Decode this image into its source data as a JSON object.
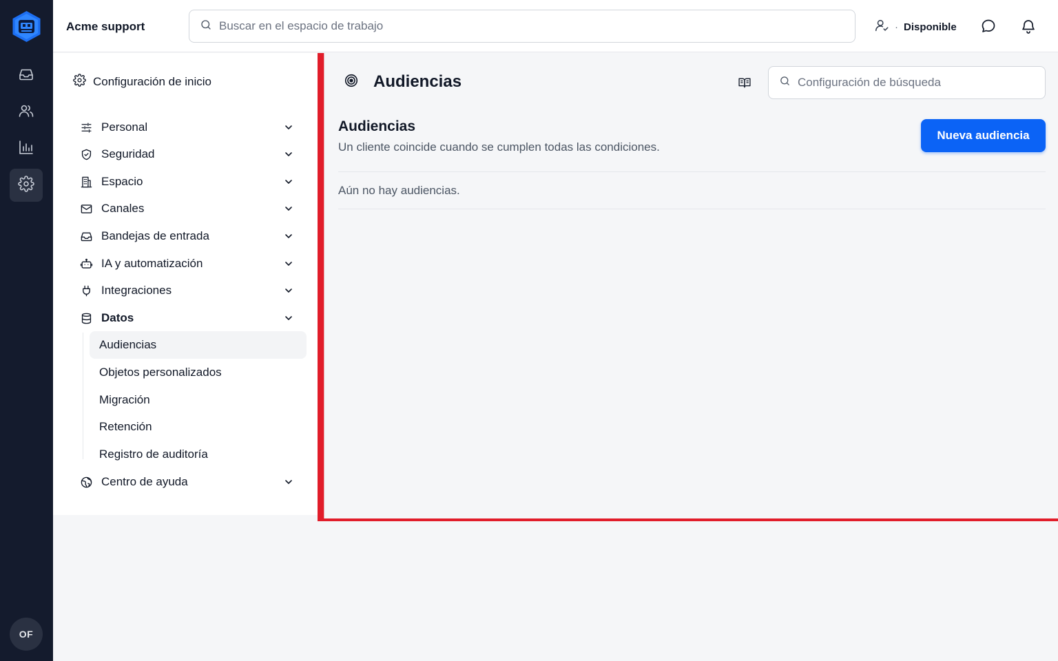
{
  "colors": {
    "rail_bg": "#141b2d",
    "accent": "#0b63f6",
    "highlight_border": "#e11d2a"
  },
  "rail": {
    "logo_icon": "bot-hexagon-logo",
    "items": [
      {
        "icon": "inbox-icon",
        "active": false
      },
      {
        "icon": "users-icon",
        "active": false
      },
      {
        "icon": "bar-chart-icon",
        "active": false
      },
      {
        "icon": "gear-icon",
        "active": true
      }
    ],
    "avatar_initials": "OF"
  },
  "topbar": {
    "workspace": "Acme support",
    "search_placeholder": "Buscar en el espacio de trabajo",
    "status_separator": "·",
    "status": "Disponible",
    "icons": [
      "user-status-icon",
      "chat-bubble-icon",
      "bell-icon"
    ]
  },
  "settings_nav": {
    "header": "Configuración de inicio",
    "items": [
      {
        "label": "Personal",
        "icon": "sliders-icon"
      },
      {
        "label": "Seguridad",
        "icon": "shield-icon"
      },
      {
        "label": "Espacio",
        "icon": "building-icon"
      },
      {
        "label": "Canales",
        "icon": "mail-icon"
      },
      {
        "label": "Bandejas de entrada",
        "icon": "inbox-icon"
      },
      {
        "label": "IA y automatización",
        "icon": "robot-icon"
      },
      {
        "label": "Integraciones",
        "icon": "plug-icon"
      },
      {
        "label": "Datos",
        "icon": "database-icon",
        "expanded": true
      },
      {
        "label": "Centro de ayuda",
        "icon": "globe-icon"
      }
    ],
    "sub_items": [
      {
        "label": "Audiencias",
        "active": true
      },
      {
        "label": "Objetos personalizados",
        "active": false
      },
      {
        "label": "Migración",
        "active": false
      },
      {
        "label": "Retención",
        "active": false
      },
      {
        "label": "Registro de auditoría",
        "active": false
      }
    ]
  },
  "main": {
    "page_title": "Audiencias",
    "page_icon": "target-icon",
    "docs_icon": "book-open-icon",
    "search_placeholder": "Configuración de búsqueda",
    "section_title": "Audiencias",
    "section_description": "Un cliente coincide cuando se cumplen todas las condiciones.",
    "new_button": "Nueva audiencia",
    "empty_state": "Aún no hay audiencias."
  }
}
